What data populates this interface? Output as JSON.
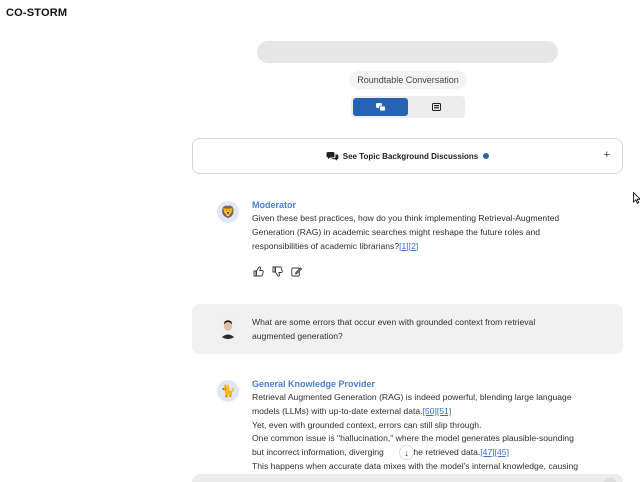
{
  "app": {
    "title": "CO-STORM"
  },
  "header": {
    "mode_label": "Roundtable Conversation",
    "view_toggle": [
      {
        "icon": "chat-bubbles-icon",
        "active": true
      },
      {
        "icon": "newspaper-icon",
        "active": false
      }
    ]
  },
  "background_card": {
    "label": "See Topic Background Discussions",
    "expand_symbol": "+",
    "dot_color": "#2f63a8"
  },
  "messages": [
    {
      "speaker": "Moderator",
      "avatar": "lion-emoji",
      "lines": [
        "Given these best practices, how do you think implementing Retrieval-Augmented",
        "Generation (RAG) in academic searches might reshape the future roles and"
      ],
      "line3_text": "responsibilities of academic librarians?",
      "line3_citations": [
        "[1]",
        "[2]"
      ]
    },
    {
      "speaker": "",
      "avatar": "user-photo",
      "lines": [
        "What are some errors that occur even with grounded context from retrieval",
        "augmented generation?"
      ]
    },
    {
      "speaker": "General Knowledge Provider",
      "avatar": "fox-emoji",
      "line1": "Retrieval Augmented Generation (RAG) is indeed powerful, blending large language",
      "line2_text": "models (LLMs) with up-to-date external data.",
      "line2_citations": [
        "[50]",
        "[51]"
      ],
      "line3": "Yet, even with grounded context, errors can still slip through.",
      "line4": "One common issue is \"hallucination,\" where the model generates plausible-sounding",
      "line5_before": "but incorrect information, diverging",
      "line5_after": "n the retrieved data.",
      "line5_citations": [
        "[47]",
        "[45]"
      ],
      "line6": "This happens when accurate data mixes with the model's internal knowledge, causing"
    }
  ],
  "accent_color": "#2563b4",
  "speaker_color": "#4a7fd1"
}
